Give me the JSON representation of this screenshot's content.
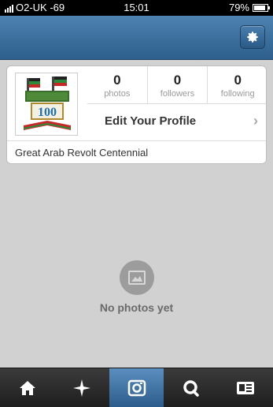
{
  "status_bar": {
    "carrier": "O2-UK -69",
    "time": "15:01",
    "battery": "79%"
  },
  "nav_bar": {
    "settings_icon": "gear-icon"
  },
  "profile": {
    "stats": [
      {
        "count": "0",
        "label": "photos"
      },
      {
        "count": "0",
        "label": "followers"
      },
      {
        "count": "0",
        "label": "following"
      }
    ],
    "edit_label": "Edit Your Profile",
    "bio": "Great Arab Revolt Centennial",
    "avatar_text": "100"
  },
  "empty_state": {
    "text": "No photos yet",
    "icon": "image-icon"
  },
  "tab_bar": {
    "tabs": [
      {
        "icon": "home-icon",
        "active": false
      },
      {
        "icon": "explore-icon",
        "active": false
      },
      {
        "icon": "camera-icon",
        "active": true
      },
      {
        "icon": "news-icon",
        "active": false
      },
      {
        "icon": "profile-icon",
        "active": false
      }
    ]
  },
  "colors": {
    "nav_blue": "#3d6f9e",
    "background": "#d1d1d1",
    "tab_dark": "#2a2a2a"
  }
}
